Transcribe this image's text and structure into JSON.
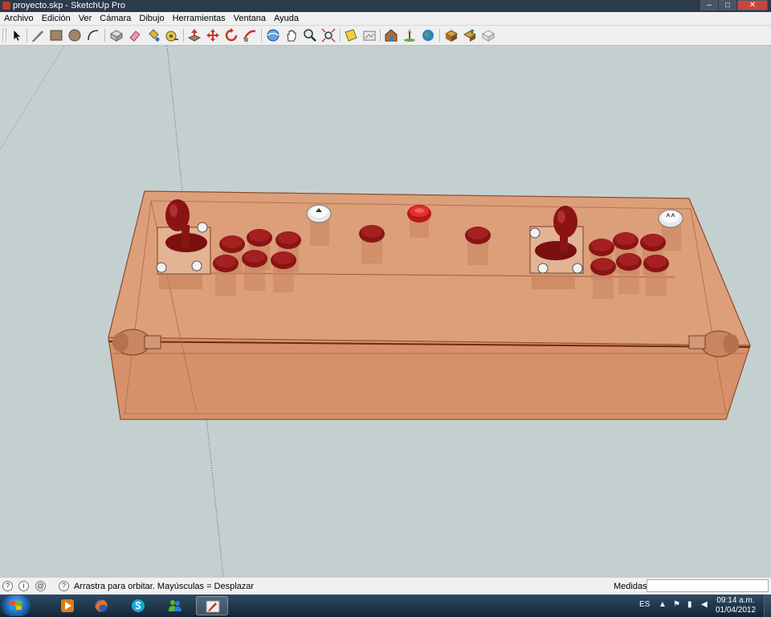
{
  "window": {
    "title": "proyecto.skp - SketchUp Pro",
    "controls": {
      "minimize": "–",
      "maximize": "□",
      "close": "✕"
    }
  },
  "menu": [
    {
      "label": "Archivo"
    },
    {
      "label": "Edición"
    },
    {
      "label": "Ver"
    },
    {
      "label": "Cámara"
    },
    {
      "label": "Dibujo"
    },
    {
      "label": "Herramientas"
    },
    {
      "label": "Ventana"
    },
    {
      "label": "Ayuda"
    }
  ],
  "toolbar": {
    "tools": [
      "select-tool-icon",
      "pencil-line-icon",
      "rectangle-icon",
      "circle-icon",
      "arc-icon",
      "make-component-icon",
      "eraser-icon",
      "paint-bucket-icon",
      "tape-measure-icon",
      "push-pull-icon",
      "move-icon",
      "rotate-icon",
      "follow-me-icon",
      "orbit-icon",
      "pan-icon",
      "zoom-icon",
      "zoom-extents-icon",
      "section-plane-icon",
      "import-icon",
      "warehouse-icon",
      "add-location-icon",
      "google-earth-icon",
      "get-models-icon",
      "share-model-icon",
      "extension-icon"
    ]
  },
  "status": {
    "hint": "Arrastra para orbitar. Mayúsculas = Desplazar",
    "measurements_label": "Medidas",
    "measurements_value": ""
  },
  "taskbar": {
    "apps": [
      "media-player-icon",
      "firefox-icon",
      "skype-icon",
      "messenger-icon",
      "sketchup-icon"
    ],
    "language": "ES",
    "time": "09:14 a.m.",
    "date": "01/04/2012"
  },
  "colors": {
    "viewport_bg": "#c4d0cf",
    "box_fill": "#d9946b",
    "button_red": "#8a1414",
    "start_button": "#57a7f0"
  }
}
